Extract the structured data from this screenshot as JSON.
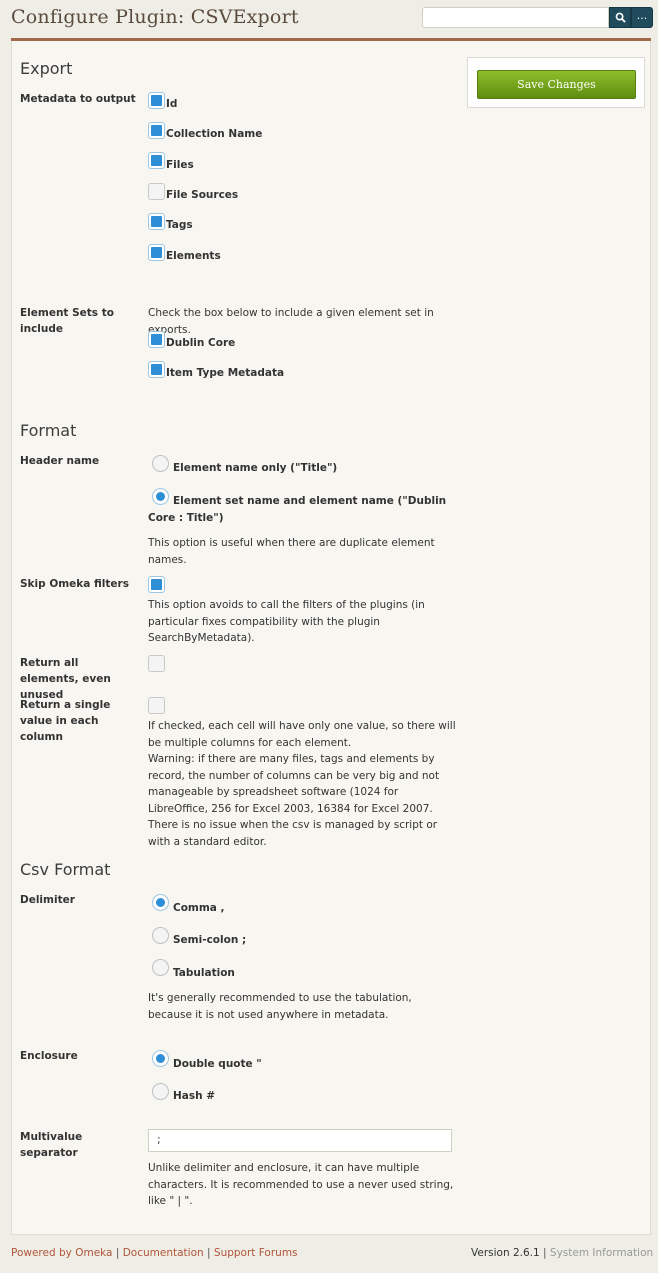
{
  "header": {
    "title": "Configure Plugin: CSVExport",
    "search": {
      "value": "",
      "placeholder": ""
    },
    "advanced_search_label": "..."
  },
  "save_button_label": "Save Changes",
  "export": {
    "title": "Export",
    "metadata_label": "Metadata to output",
    "metadata_options": [
      {
        "label": "Id",
        "checked": true
      },
      {
        "label": "Collection Name",
        "checked": true
      },
      {
        "label": "Files",
        "checked": true
      },
      {
        "label": "File Sources",
        "checked": false
      },
      {
        "label": "Tags",
        "checked": true
      },
      {
        "label": "Elements",
        "checked": true
      }
    ],
    "element_sets_label": "Element Sets to include",
    "element_sets_desc": "Check the box below to include a given element set in exports.",
    "element_sets": [
      {
        "label": "Dublin Core",
        "checked": true
      },
      {
        "label": "Item Type Metadata",
        "checked": true
      }
    ]
  },
  "format": {
    "title": "Format",
    "header_name_label": "Header name",
    "header_name_options": [
      {
        "label": "Element name only (\"Title\")",
        "checked": false
      },
      {
        "label": "Element set name and element name (\"Dublin Core : Title\")",
        "checked": true
      }
    ],
    "header_name_desc": "This option is useful when there are duplicate element names.",
    "skip_filters_label": "Skip Omeka filters",
    "skip_filters_checked": true,
    "skip_filters_desc": "This option avoids to call the filters of the plugins (in particular fixes compatibility with the plugin SearchByMetadata).",
    "return_all_label": "Return all elements, even unused",
    "return_all_checked": false,
    "single_value_label": "Return a single value in each column",
    "single_value_checked": false,
    "single_value_desc": "If checked, each cell will have only one value, so there will be multiple columns for each element.",
    "single_value_warning": "Warning: if there are many files, tags and elements by record, the number of columns can be very big and not manageable by spreadsheet software (1024 for LibreOffice, 256 for Excel 2003, 16384 for Excel 2007. There is no issue when the csv is managed by script or with a standard editor."
  },
  "csv": {
    "title": "Csv Format",
    "delimiter_label": "Delimiter",
    "delimiter_options": [
      {
        "label": "Comma ,",
        "checked": true
      },
      {
        "label": "Semi-colon ;",
        "checked": false
      },
      {
        "label": "Tabulation",
        "checked": false
      }
    ],
    "delimiter_desc": "It's generally recommended to use the tabulation, because it is not used anywhere in metadata.",
    "enclosure_label": "Enclosure",
    "enclosure_options": [
      {
        "label": "Double quote \"",
        "checked": true
      },
      {
        "label": "Hash #",
        "checked": false
      }
    ],
    "separator_label": "Multivalue separator",
    "separator_value": ";",
    "separator_desc": "Unlike delimiter and enclosure, it can have multiple characters. It is recommended to use a never used string, like \" | \"."
  },
  "footer": {
    "powered_by": "Powered by Omeka",
    "documentation": "Documentation",
    "support_forums": "Support Forums",
    "version": "Version 2.6.1",
    "system_info": "System Information",
    "separator": "|"
  }
}
